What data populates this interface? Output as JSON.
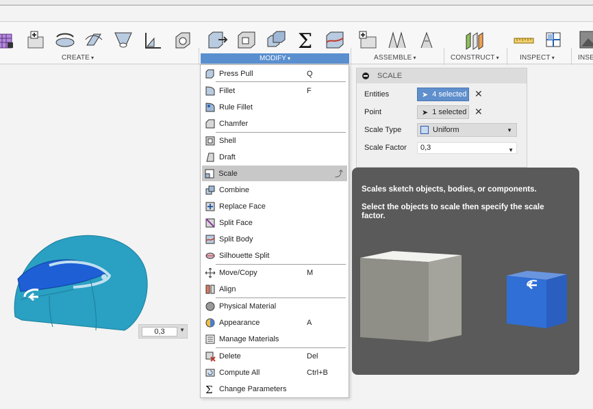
{
  "toolbar": {
    "groups": {
      "create": "CREATE",
      "modify": "MODIFY",
      "assemble": "ASSEMBLE",
      "construct": "CONSTRUCT",
      "inspect": "INSPECT",
      "insert": "INSE"
    },
    "create_icons": [
      "form-icon",
      "sketch-icon",
      "revolve-icon",
      "sweep-icon",
      "loft-icon",
      "rib-icon",
      "box-icon"
    ],
    "modify_icons": [
      "press-pull-icon",
      "shell-icon",
      "combine-icon",
      "parameters-sigma-icon",
      "split-body-icon"
    ],
    "assemble_icons": [
      "new-component-icon",
      "joint-icon",
      "as-built-joint-icon"
    ],
    "construct_icon": "offset-plane-icon",
    "inspect_icons": [
      "measure-icon",
      "section-analysis-icon"
    ],
    "insert_icon": "insert-image-icon",
    "accent_color": "#5a8fcf"
  },
  "menu": {
    "items": [
      {
        "label": "Press Pull",
        "shortcut": "Q",
        "icon": "press-pull-icon"
      },
      {
        "label": "Fillet",
        "shortcut": "F",
        "icon": "fillet-icon"
      },
      {
        "label": "Rule Fillet",
        "shortcut": "",
        "icon": "rule-fillet-icon"
      },
      {
        "label": "Chamfer",
        "shortcut": "",
        "icon": "chamfer-icon"
      },
      {
        "label": "Shell",
        "shortcut": "",
        "icon": "shell-icon"
      },
      {
        "label": "Draft",
        "shortcut": "",
        "icon": "draft-icon"
      },
      {
        "label": "Scale",
        "shortcut": "",
        "icon": "scale-icon"
      },
      {
        "label": "Combine",
        "shortcut": "",
        "icon": "combine-icon"
      },
      {
        "label": "Replace Face",
        "shortcut": "",
        "icon": "replace-face-icon"
      },
      {
        "label": "Split Face",
        "shortcut": "",
        "icon": "split-face-icon"
      },
      {
        "label": "Split Body",
        "shortcut": "",
        "icon": "split-body-icon"
      },
      {
        "label": "Silhouette Split",
        "shortcut": "",
        "icon": "silhouette-split-icon"
      },
      {
        "label": "Move/Copy",
        "shortcut": "M",
        "icon": "move-icon"
      },
      {
        "label": "Align",
        "shortcut": "",
        "icon": "align-icon"
      },
      {
        "label": "Physical Material",
        "shortcut": "",
        "icon": "physical-material-icon"
      },
      {
        "label": "Appearance",
        "shortcut": "A",
        "icon": "appearance-icon"
      },
      {
        "label": "Manage Materials",
        "shortcut": "",
        "icon": "manage-materials-icon"
      },
      {
        "label": "Delete",
        "shortcut": "Del",
        "icon": "delete-icon"
      },
      {
        "label": "Compute All",
        "shortcut": "Ctrl+B",
        "icon": "compute-all-icon"
      },
      {
        "label": "Change Parameters",
        "shortcut": "",
        "icon": "parameters-sigma-icon"
      }
    ],
    "selected": "Scale"
  },
  "dialog": {
    "title": "SCALE",
    "entities_label": "Entities",
    "entities_value": "4 selected",
    "point_label": "Point",
    "point_value": "1 selected",
    "scale_type_label": "Scale Type",
    "scale_type_value": "Uniform",
    "scale_factor_label": "Scale Factor",
    "scale_factor_value": "0,3"
  },
  "tooltip": {
    "line1": "Scales sketch objects, bodies, or components.",
    "line2": "Select the objects to scale then specify the scale factor."
  },
  "canvas": {
    "value_box": "0,3"
  }
}
